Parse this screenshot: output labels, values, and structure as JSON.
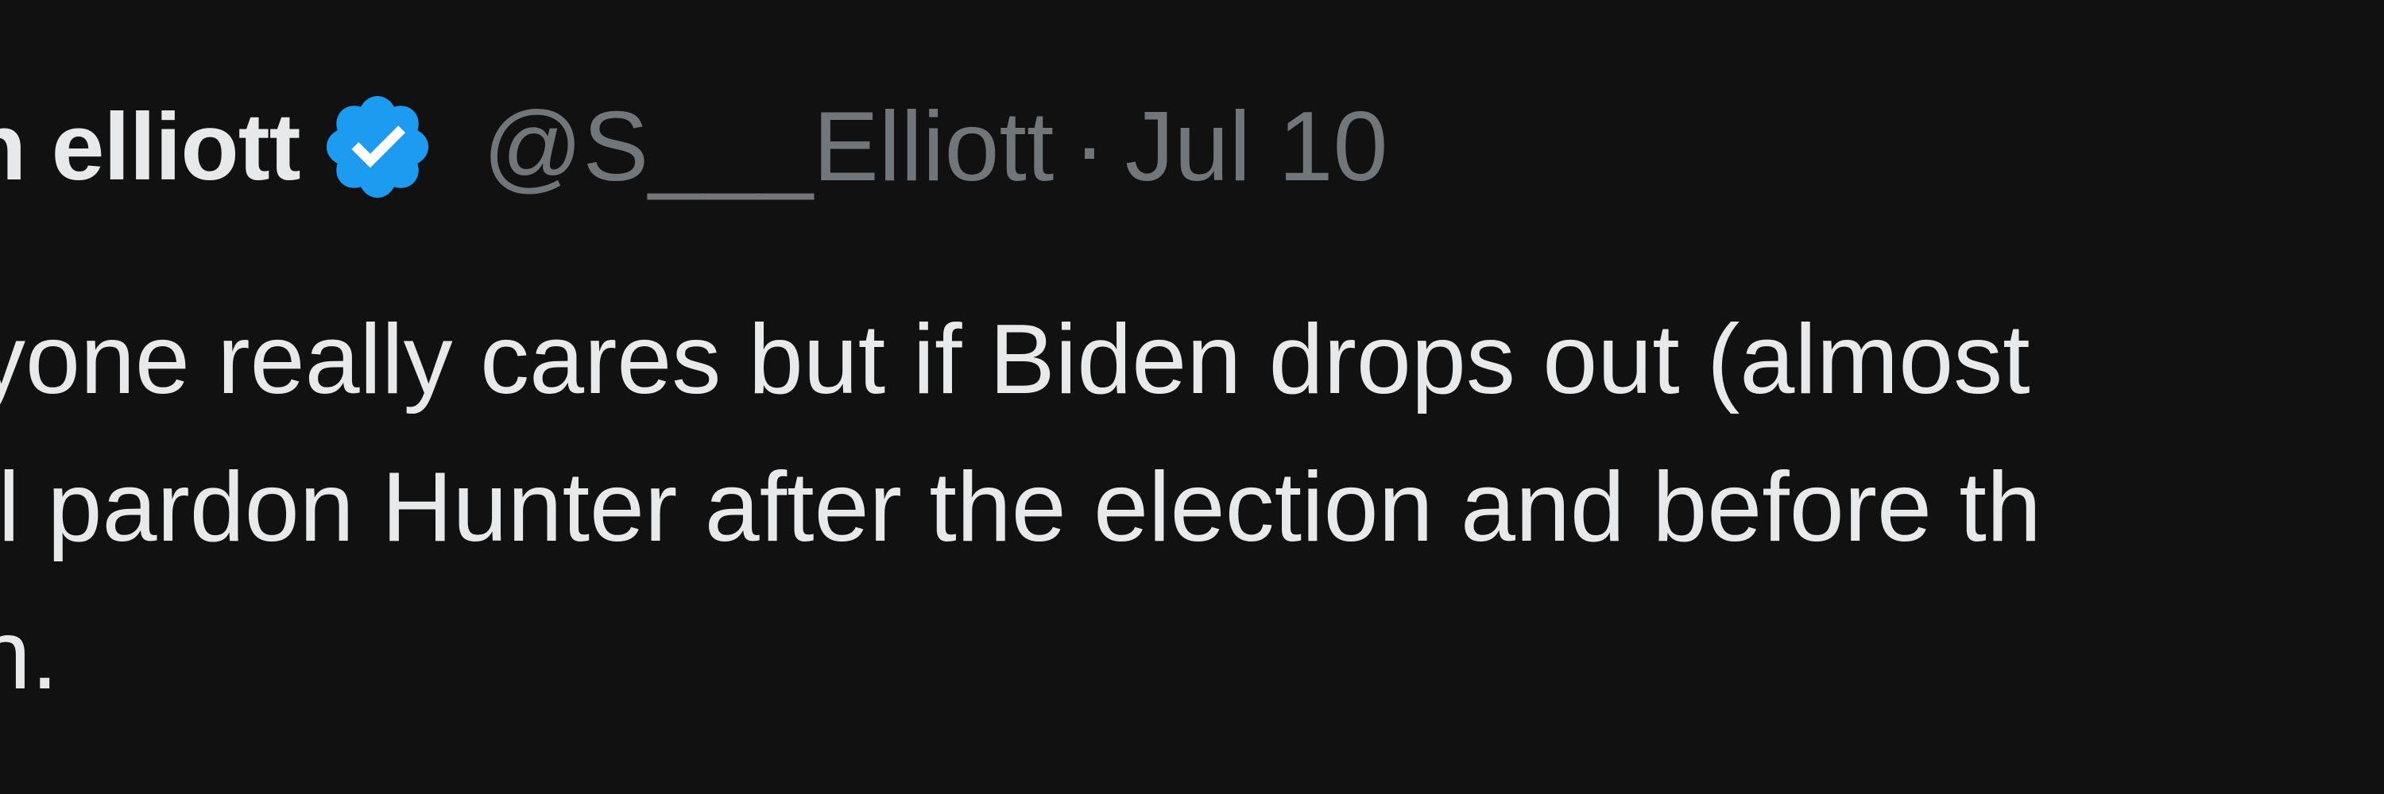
{
  "tweet": {
    "display_name": "n elliott",
    "handle": "@S___Elliott",
    "separator": "·",
    "date": "Jul 10",
    "lines": [
      "yone really cares but if Biden drops out (almost",
      "ll pardon Hunter after the election and before th",
      "n."
    ]
  },
  "icons": {
    "verified_badge": "verified-badge-icon"
  },
  "colors": {
    "background": "#111112",
    "primary_text": "#e7e9ea",
    "secondary_text": "#71767b",
    "verified_blue": "#1d9bf0"
  }
}
